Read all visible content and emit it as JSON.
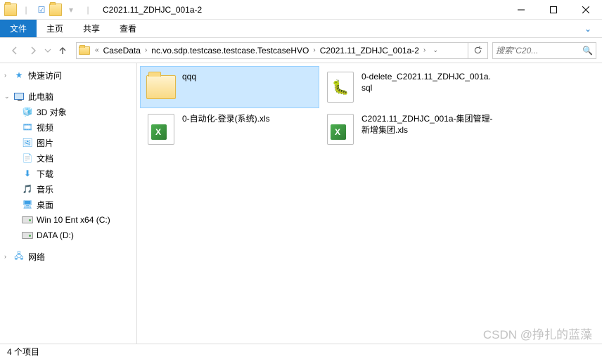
{
  "window": {
    "title": "C2021.11_ZDHJC_001a-2"
  },
  "ribbon": {
    "file": "文件",
    "tabs": [
      "主页",
      "共享",
      "查看"
    ]
  },
  "breadcrumb": {
    "segments": [
      "CaseData",
      "nc.vo.sdp.testcase.testcase.TestcaseHVO",
      "C2021.11_ZDHJC_001a-2"
    ]
  },
  "search": {
    "placeholder": "搜索\"C20..."
  },
  "sidebar": {
    "quick_access": "快速访问",
    "this_pc": "此电脑",
    "pc_items": [
      {
        "label": "3D 对象",
        "icon": "cube"
      },
      {
        "label": "视频",
        "icon": "video"
      },
      {
        "label": "图片",
        "icon": "picture"
      },
      {
        "label": "文档",
        "icon": "document"
      },
      {
        "label": "下载",
        "icon": "download"
      },
      {
        "label": "音乐",
        "icon": "music"
      },
      {
        "label": "桌面",
        "icon": "desktop"
      },
      {
        "label": "Win 10 Ent x64 (C:)",
        "icon": "drive"
      },
      {
        "label": "DATA (D:)",
        "icon": "drive"
      }
    ],
    "network": "网络"
  },
  "files": [
    {
      "name": "qqq",
      "type": "folder",
      "selected": true
    },
    {
      "name": "0-delete_C2021.11_ZDHJC_001a.sql",
      "type": "sql"
    },
    {
      "name": "0-自动化-登录(系统).xls",
      "type": "xls"
    },
    {
      "name": "C2021.11_ZDHJC_001a-集团管理-新增集团.xls",
      "type": "xls"
    }
  ],
  "status": {
    "item_count": "4 个项目"
  },
  "watermark": "CSDN @挣扎的蓝藻"
}
